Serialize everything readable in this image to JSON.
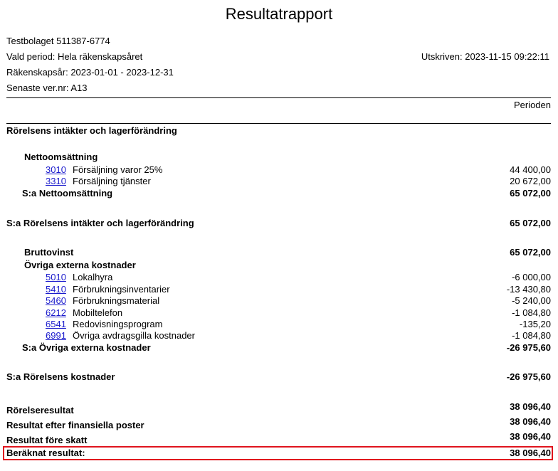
{
  "title": "Resultatrapport",
  "company": "Testbolaget 511387-6774",
  "period": "Vald period: Hela räkenskapsåret",
  "printed": "Utskriven: 2023-11-15 09:22:11",
  "fiscal_year": "Räkenskapsår: 2023-01-01 - 2023-12-31",
  "latest_ver": "Senaste ver.nr: A13",
  "column_header": "Perioden",
  "section_revenue": "Rörelsens intäkter och lagerförändring",
  "nettoomsattning": {
    "heading": "Nettoomsättning",
    "accounts": [
      {
        "number": "3010",
        "name": "Försäljning varor 25%",
        "amount": "44 400,00"
      },
      {
        "number": "3310",
        "name": "Försäljning tjänster",
        "amount": "20 672,00"
      }
    ],
    "sum_label": "S:a Nettoomsättning",
    "sum_amount": "65 072,00"
  },
  "sum_revenue": {
    "label": "S:a Rörelsens intäkter och lagerförändring",
    "amount": "65 072,00"
  },
  "bruttovinst": {
    "label": "Bruttovinst",
    "amount": "65 072,00"
  },
  "ovriga": {
    "heading": "Övriga externa kostnader",
    "accounts": [
      {
        "number": "5010",
        "name": "Lokalhyra",
        "amount": "-6 000,00"
      },
      {
        "number": "5410",
        "name": "Förbrukningsinventarier",
        "amount": "-13 430,80"
      },
      {
        "number": "5460",
        "name": "Förbrukningsmaterial",
        "amount": "-5 240,00"
      },
      {
        "number": "6212",
        "name": "Mobiltelefon",
        "amount": "-1 084,80"
      },
      {
        "number": "6541",
        "name": "Redovisningsprogram",
        "amount": "-135,20"
      },
      {
        "number": "6991",
        "name": "Övriga avdragsgilla kostnader",
        "amount": "-1 084,80"
      }
    ],
    "sum_label": "S:a Övriga externa kostnader",
    "sum_amount": "-26 975,60"
  },
  "sum_costs": {
    "label": "S:a Rörelsens kostnader",
    "amount": "-26 975,60"
  },
  "results": [
    {
      "label": "Rörelseresultat",
      "amount": "38 096,40"
    },
    {
      "label": "Resultat efter finansiella poster",
      "amount": "38 096,40"
    },
    {
      "label": "Resultat före skatt",
      "amount": "38 096,40"
    }
  ],
  "calculated": {
    "label": "Beräknat resultat:",
    "amount": "38 096,40"
  },
  "highlight_color": "#e0141e",
  "link_color": "#1a1acc"
}
